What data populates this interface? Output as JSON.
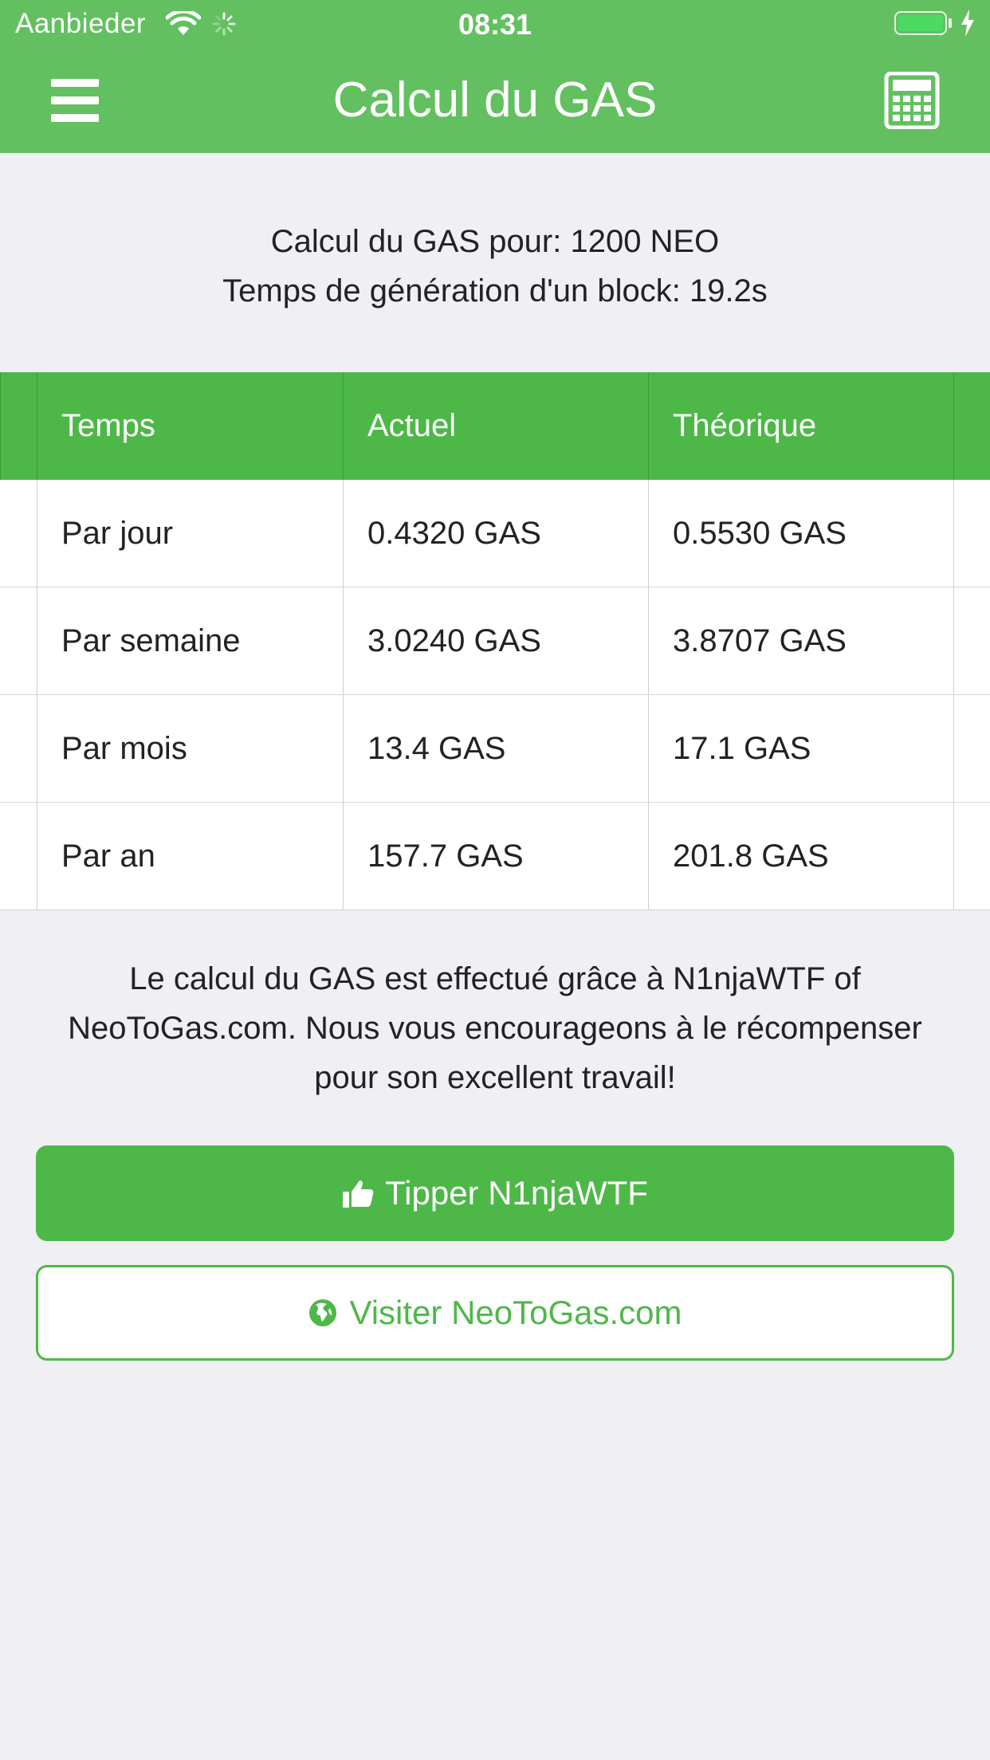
{
  "status_bar": {
    "carrier": "Aanbieder",
    "time": "08:31"
  },
  "header": {
    "title": "Calcul du GAS",
    "menu_icon": "hamburger-menu-icon",
    "calculator_icon": "calculator-icon"
  },
  "info": {
    "line1": "Calcul du GAS pour: 1200 NEO",
    "line2": "Temps de génération d'un block: 19.2s"
  },
  "table": {
    "headers": [
      "Temps",
      "Actuel",
      "Théorique"
    ],
    "rows": [
      [
        "Par jour",
        "0.4320 GAS",
        "0.5530 GAS"
      ],
      [
        "Par semaine",
        "3.0240 GAS",
        "3.8707 GAS"
      ],
      [
        "Par mois",
        "13.4 GAS",
        "17.1 GAS"
      ],
      [
        "Par an",
        "157.7 GAS",
        "201.8 GAS"
      ]
    ]
  },
  "credit": {
    "text": "Le calcul du GAS est effectué grâce à N1njaWTF of NeoToGas.com. Nous vous encourageons à le récompenser pour son excellent travail!"
  },
  "buttons": {
    "tip_label": "Tipper N1njaWTF",
    "tip_icon": "thumbs-up-icon",
    "visit_label": "Visiter NeoToGas.com",
    "visit_icon": "globe-icon"
  },
  "colors": {
    "header_green": "#63c060",
    "accent_green": "#4db848",
    "background": "#efeff4"
  }
}
